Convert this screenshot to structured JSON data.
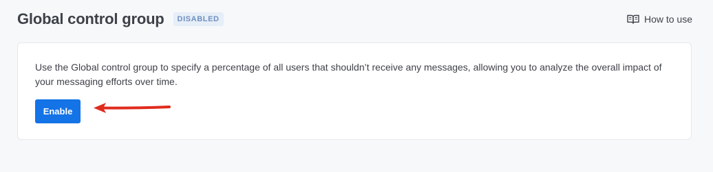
{
  "header": {
    "title": "Global control group",
    "status_badge": "DISABLED",
    "help_link": "How to use"
  },
  "card": {
    "description": "Use the Global control group to specify a percentage of all users that shouldn’t receive any messages, allowing you to analyze the overall impact of your messaging efforts over time.",
    "enable_label": "Enable"
  },
  "icons": {
    "help": "open-book-icon",
    "annotation": "red-arrow-icon"
  },
  "colors": {
    "primary_button": "#1473e6",
    "badge_bg": "#e6eef8",
    "badge_text": "#6f8fbf",
    "annotation_arrow": "#e02b1d",
    "page_bg": "#f7f8fa"
  }
}
